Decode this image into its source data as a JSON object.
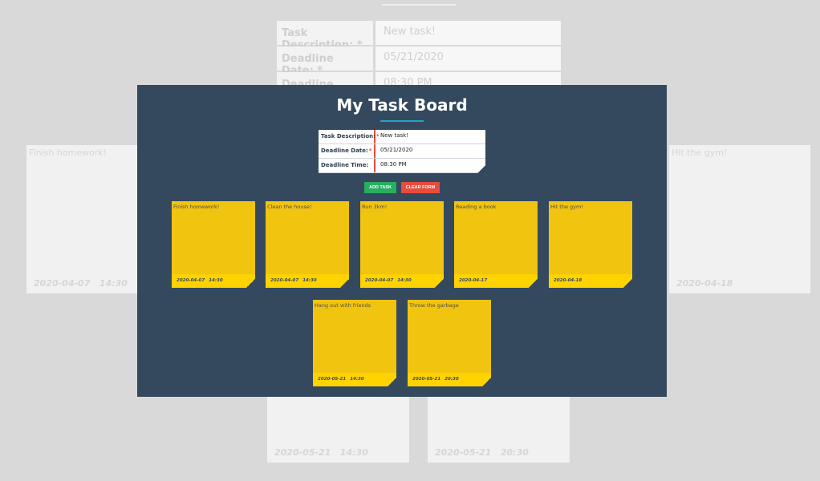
{
  "board": {
    "title": "My Task Board"
  },
  "form": {
    "description_label": "Task Description:",
    "description_value": "New task!",
    "date_label": "Deadline Date:",
    "date_value": "05/21/2020",
    "time_label": "Deadline Time:",
    "time_value": "08:30 PM",
    "required_mark": "*"
  },
  "buttons": {
    "add": "ADD TASK",
    "clear": "CLEAR FORM"
  },
  "tasks": [
    {
      "text": "Finish homework!",
      "date": "2020-04-07",
      "time": "14:30"
    },
    {
      "text": "Clean the house!",
      "date": "2020-04-07",
      "time": "14:30"
    },
    {
      "text": "Run 3km!",
      "date": "2020-04-07",
      "time": "14:30"
    },
    {
      "text": "Reading a book",
      "date": "2020-04-17",
      "time": ""
    },
    {
      "text": "Hit the gym!",
      "date": "2020-04-18",
      "time": ""
    },
    {
      "text": "Hang out with friends",
      "date": "2020-05-21",
      "time": "14:30"
    },
    {
      "text": "Throw the garbage",
      "date": "2020-05-21",
      "time": "20:30"
    }
  ],
  "colors": {
    "board_bg": "#34495e",
    "note_bg": "#f1c40f",
    "note_footer": "#ffd300",
    "add_button": "#27ae60",
    "clear_button": "#e74c3c",
    "title_underline": "#1fa7c8"
  }
}
